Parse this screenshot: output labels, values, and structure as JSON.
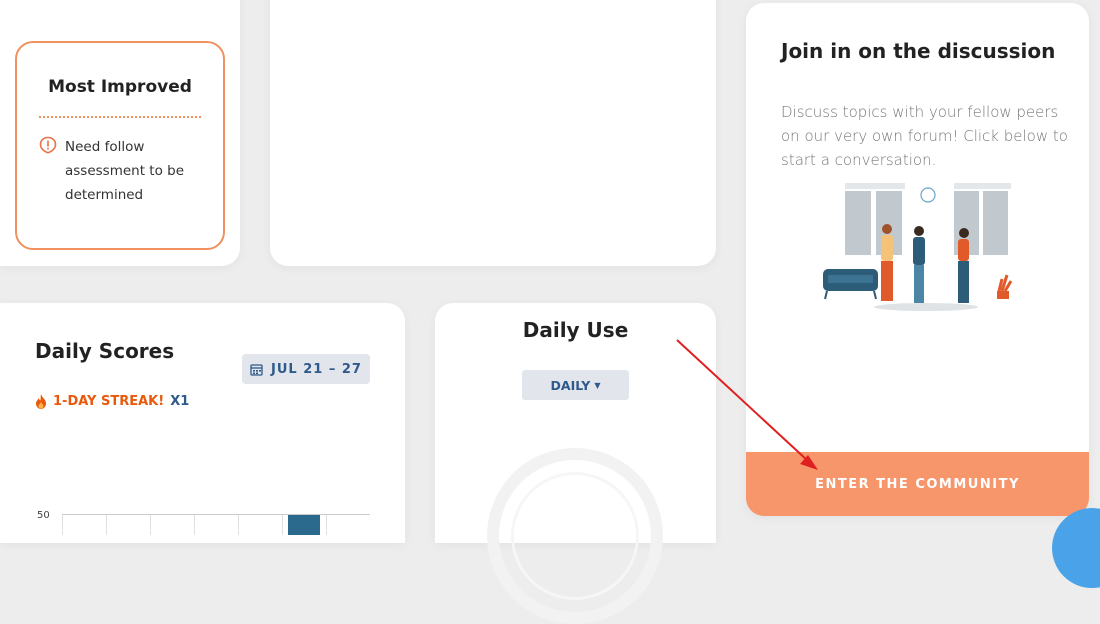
{
  "most_improved": {
    "title": "Most Improved",
    "message": "Need follow assessment to be determined"
  },
  "discussion": {
    "title": "Join in on the discussion",
    "description": "Discuss topics with your fellow peers on our very own forum! Click below to start a conversation.",
    "button_label": "ENTER THE COMMUNITY"
  },
  "daily_scores": {
    "title": "Daily Scores",
    "date_range": "JUL 21 – 27",
    "streak_label": "1-DAY STREAK!",
    "streak_multiplier": "X1",
    "y_tick_top": "50"
  },
  "daily_use": {
    "title": "Daily Use",
    "period_select": "DAILY"
  },
  "colors": {
    "accent_orange": "#f7956b",
    "border_orange": "#f0925f",
    "navy": "#2d5a8a",
    "bar": "#2b6a8c",
    "annotation": "#e02020"
  }
}
